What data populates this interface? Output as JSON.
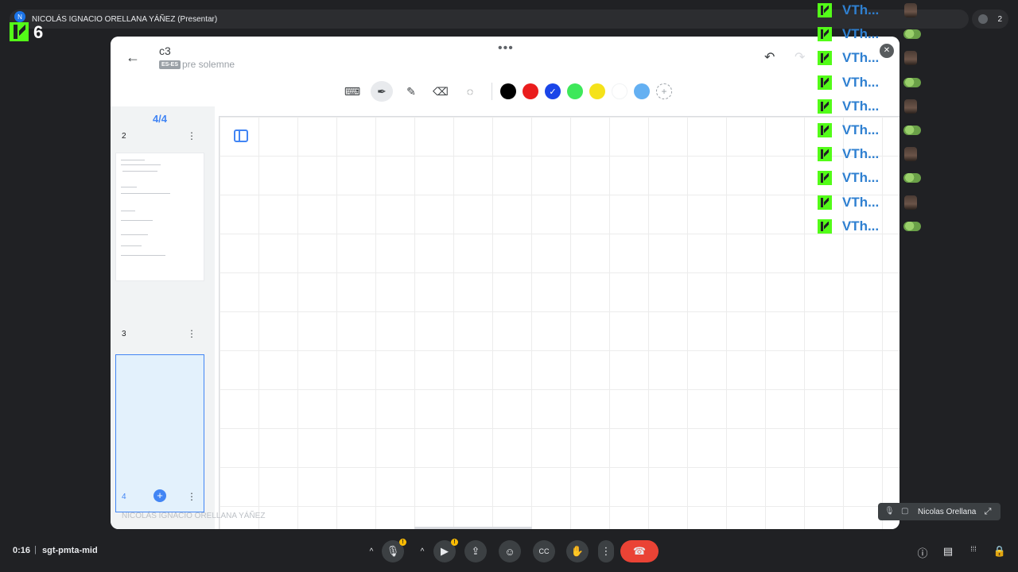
{
  "presenter_bar": {
    "badge": "N",
    "label": "NICOLÁS IGNACIO ORELLANA YÁÑEZ (Presentar)"
  },
  "kick": {
    "viewer_count": "6"
  },
  "participants": {
    "count": "2"
  },
  "whiteboard": {
    "title": "c3",
    "lang_tag": "ES-ES",
    "subtitle": "pre solemne",
    "menu_dots": "•••",
    "undo": "↶",
    "redo": "↷",
    "tools": [
      {
        "name": "keyboard-icon",
        "glyph": "⌨",
        "active": false
      },
      {
        "name": "pen-icon",
        "glyph": "✒",
        "active": true
      },
      {
        "name": "highlighter-icon",
        "glyph": "✎",
        "active": false
      },
      {
        "name": "eraser-icon",
        "glyph": "⌫",
        "active": false
      },
      {
        "name": "lasso-icon",
        "glyph": "◌",
        "active": false
      }
    ],
    "colors": [
      {
        "name": "black",
        "hex": "#000000",
        "selected": false
      },
      {
        "name": "red",
        "hex": "#ea1d1d",
        "selected": false
      },
      {
        "name": "blue",
        "hex": "#1a45e8",
        "selected": true
      },
      {
        "name": "green",
        "hex": "#3ee85a",
        "selected": false
      },
      {
        "name": "yellow",
        "hex": "#f5e21a",
        "selected": false
      },
      {
        "name": "white",
        "hex": "#ffffff",
        "selected": false
      },
      {
        "name": "light-blue",
        "hex": "#64b0f2",
        "selected": false
      }
    ],
    "add_color": "+",
    "selected_check": "✓",
    "page_counter": "4/4",
    "pages": [
      {
        "number": "2",
        "menu": "⋮"
      },
      {
        "number": "3",
        "menu": "⋮"
      },
      {
        "number": "4",
        "menu": "⋮"
      }
    ],
    "add_page": "+",
    "owner_name": "NICOLÁS IGNACIO ORELLANA YÁÑEZ"
  },
  "chat": {
    "messages": [
      {
        "text": "VTh...",
        "emote": "face"
      },
      {
        "text": "VTh...",
        "emote": "frog"
      },
      {
        "text": "VTh...",
        "emote": "face"
      },
      {
        "text": "VTh...",
        "emote": "frog"
      },
      {
        "text": "VTh...",
        "emote": "face"
      },
      {
        "text": "VTh...",
        "emote": "frog"
      },
      {
        "text": "VTh...",
        "emote": "face"
      },
      {
        "text": "VTh...",
        "emote": "frog"
      },
      {
        "text": "VTh...",
        "emote": "face"
      },
      {
        "text": "VTh...",
        "emote": "frog"
      }
    ]
  },
  "self_view": {
    "name": "Nicolas Orellana",
    "mic_icon": "🎙",
    "cam_icon": "▢",
    "expand_icon": "⤢"
  },
  "meeting": {
    "time": "0:16",
    "separator": "|",
    "code": "sgt-pmta-mid",
    "controls": [
      {
        "name": "mic-options-chevron",
        "glyph": "^"
      },
      {
        "name": "mic-button",
        "glyph": "🎙",
        "warn": "!"
      },
      {
        "name": "camera-options-chevron",
        "glyph": "^"
      },
      {
        "name": "camera-button",
        "glyph": "▶",
        "warn": "!"
      },
      {
        "name": "present-button",
        "glyph": "⇪"
      },
      {
        "name": "reactions-button",
        "glyph": "☺"
      },
      {
        "name": "captions-button",
        "glyph": "CC"
      },
      {
        "name": "raise-hand-button",
        "glyph": "✋"
      },
      {
        "name": "more-options-button",
        "glyph": "⋮"
      },
      {
        "name": "end-call-button",
        "glyph": "☎"
      }
    ],
    "right_icons": [
      {
        "name": "info-icon",
        "glyph": "ⓘ"
      },
      {
        "name": "chat-icon",
        "glyph": "▤"
      },
      {
        "name": "activities-icon",
        "glyph": "⁞⁞⁞"
      },
      {
        "name": "host-controls-icon",
        "glyph": "🔒"
      }
    ]
  }
}
